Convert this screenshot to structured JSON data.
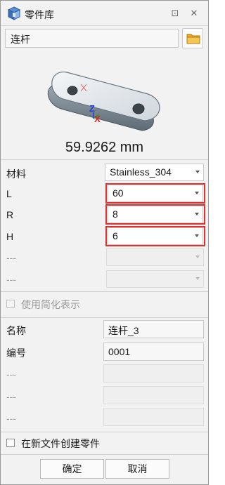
{
  "window": {
    "title": "零件库"
  },
  "titlebar": {
    "pin_glyph": "⊡",
    "close_glyph": "✕"
  },
  "part": {
    "name": "连杆",
    "size_text": "59.9262 mm"
  },
  "params": {
    "material": {
      "label": "材料",
      "value": "Stainless_304"
    },
    "L": {
      "label": "L",
      "value": "60"
    },
    "R": {
      "label": "R",
      "value": "8"
    },
    "H": {
      "label": "H",
      "value": "6"
    },
    "empty1": {
      "label": "---"
    },
    "empty2": {
      "label": "---"
    }
  },
  "simplified": {
    "label": "使用简化表示",
    "checked": false,
    "enabled": false
  },
  "props": {
    "name": {
      "label": "名称",
      "value": "连杆_3"
    },
    "number": {
      "label": "编号",
      "value": "0001"
    },
    "empty1": {
      "label": "---"
    },
    "empty2": {
      "label": "---"
    },
    "empty3": {
      "label": "---"
    }
  },
  "create_new_file": {
    "label": "在新文件创建零件",
    "checked": false
  },
  "buttons": {
    "ok": "确定",
    "cancel": "取消"
  },
  "icons": {
    "app": "part-library-icon",
    "folder": "folder-icon",
    "pin": "pin-icon",
    "close": "close-icon"
  },
  "colors": {
    "highlight": "#e03131",
    "axis_x": "#e02020",
    "axis_y": "#20a020",
    "axis_z": "#2040e0"
  }
}
